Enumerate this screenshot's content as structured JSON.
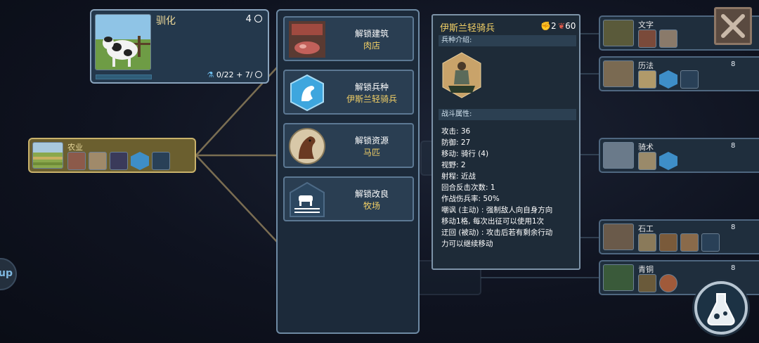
{
  "domestication": {
    "title": "驯化",
    "cost": "4",
    "progress": "0/22 + 7/",
    "progress_fraction": 0
  },
  "agriculture": {
    "title": "农业"
  },
  "unlocks": [
    {
      "label": "解锁建筑",
      "value": "肉店",
      "icon": "meat-shop-icon"
    },
    {
      "label": "解锁兵种",
      "value": "伊斯兰轻骑兵",
      "icon": "horse-unit-icon"
    },
    {
      "label": "解锁资源",
      "value": "马匹",
      "icon": "horse-resource-icon"
    },
    {
      "label": "解锁改良",
      "value": "牧场",
      "icon": "pasture-icon"
    }
  ],
  "tooltip": {
    "unit_name": "伊斯兰轻骑兵",
    "stat_a": "2",
    "stat_b": "60",
    "intro_header": "兵种介绍:",
    "combat_header": "战斗属性:",
    "attributes": [
      "攻击: 36",
      "防御: 27",
      "移动: 骑行 (4)",
      "视野: 2",
      "射程: 近战",
      "回合反击次数: 1",
      "作战伤兵率: 50%",
      "嘲讽 (主动) : 强制敌人向自身方向",
      "移动1格, 每次出征可以使用1次",
      "迂回 (被动) : 攻击后若有剩余行动",
      "力可以继续移动"
    ]
  },
  "right_nodes": [
    {
      "title": "文字",
      "cost": ""
    },
    {
      "title": "历法",
      "cost": "8"
    },
    {
      "title": "骑术",
      "cost": "8"
    },
    {
      "title": "石工",
      "cost": "8"
    },
    {
      "title": "青铜",
      "cost": "8"
    }
  ],
  "left_edge_text": "up",
  "colors": {
    "accent_gold": "#f2d066",
    "panel_bg": "#1c2a3a",
    "border": "#6e8aa4",
    "progress_fill": "#52a9d6"
  }
}
